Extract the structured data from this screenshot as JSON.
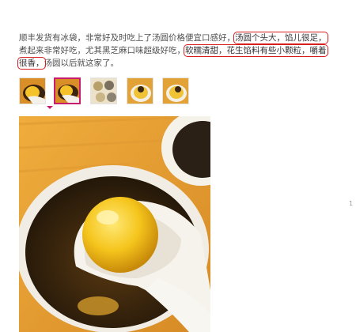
{
  "review": {
    "segments": [
      "顺丰发货有冰袋，非常好及时吃上了汤圆价格便宜口感好，",
      "汤圆个头大，馅儿很足，",
      "煮起来非常好吃，尤其黑芝麻口味超级好吃，",
      "软糯清甜，花生馅料有些小颗粒，嚼着很香，",
      "汤圆以后就这家了。"
    ]
  },
  "thumbnails": [
    {
      "name": "photo-1",
      "selected": false
    },
    {
      "name": "photo-2",
      "selected": true
    },
    {
      "name": "photo-3",
      "selected": false
    },
    {
      "name": "photo-4",
      "selected": false
    },
    {
      "name": "photo-5",
      "selected": false
    }
  ],
  "colors": {
    "highlight": "#d71d1d",
    "selected": "#c81d6e"
  },
  "side_mark": "1"
}
